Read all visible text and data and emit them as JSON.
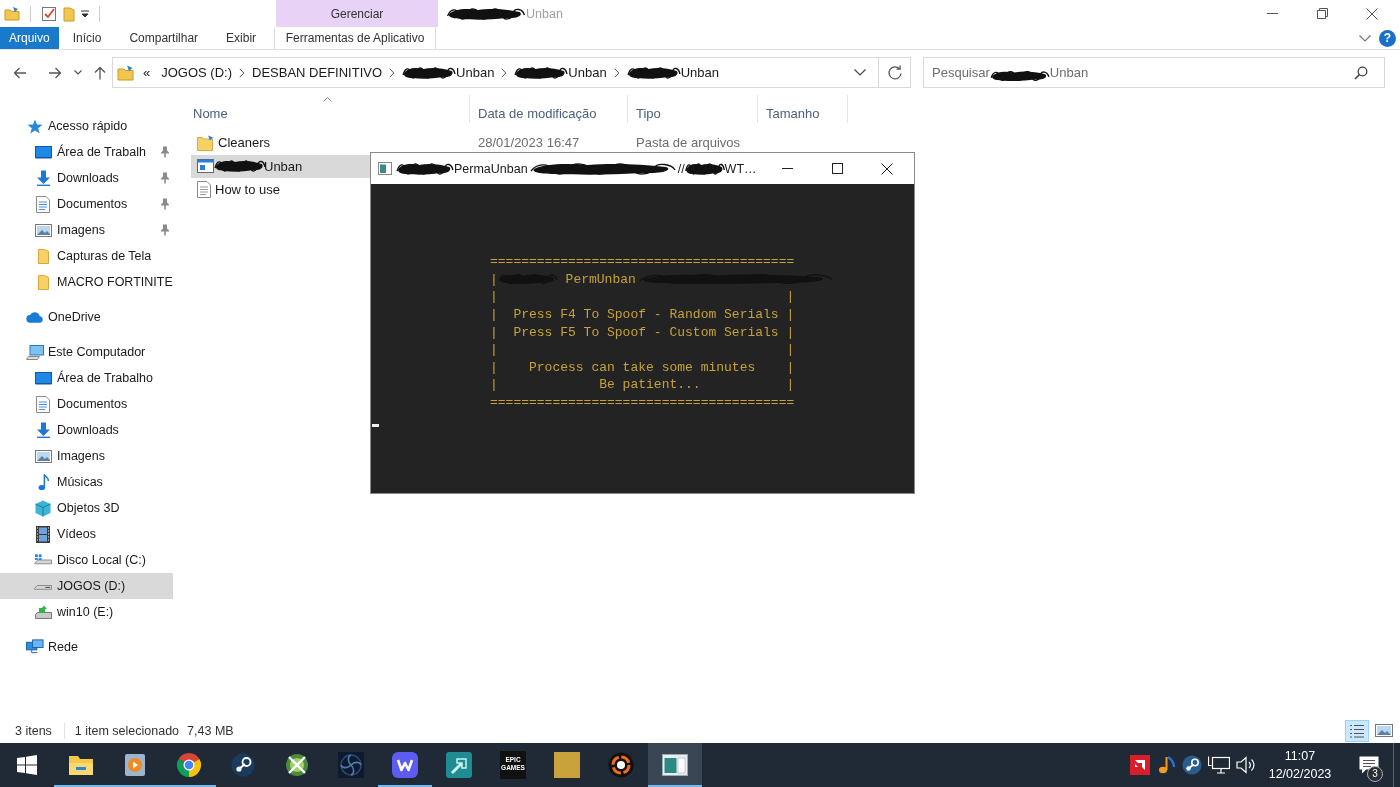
{
  "titlebar": {
    "context_group": "Gerenciar",
    "title": [
      {
        "kind": "scribble"
      },
      {
        "kind": "text",
        "text": "Unban"
      }
    ]
  },
  "ribbon": {
    "tabs": [
      {
        "label": "Arquivo",
        "kind": "file",
        "selected": false
      },
      {
        "label": "Início",
        "kind": "tab",
        "selected": false
      },
      {
        "label": "Compartilhar",
        "kind": "tab",
        "selected": false
      },
      {
        "label": "Exibir",
        "kind": "tab",
        "selected": false
      },
      {
        "label": "Ferramentas de Aplicativo",
        "kind": "context",
        "selected": false
      }
    ],
    "help": "?"
  },
  "address": {
    "overflow": "«",
    "crumbs": [
      {
        "parts": [
          {
            "kind": "text",
            "text": "JOGOS (D:)"
          }
        ]
      },
      {
        "parts": [
          {
            "kind": "text",
            "text": "DESBAN DEFINITIVO"
          }
        ]
      },
      {
        "parts": [
          {
            "kind": "scribble"
          },
          {
            "kind": "text",
            "text": "Unban"
          }
        ]
      },
      {
        "parts": [
          {
            "kind": "scribble"
          },
          {
            "kind": "text",
            "text": "Unban"
          }
        ]
      },
      {
        "parts": [
          {
            "kind": "scribble"
          },
          {
            "kind": "text",
            "text": "Unban"
          }
        ]
      }
    ]
  },
  "search": {
    "placeholder": [
      {
        "kind": "text",
        "text": "Pesquisar"
      },
      {
        "kind": "scribble"
      },
      {
        "kind": "text",
        "text": "Unban"
      }
    ]
  },
  "sidebar": {
    "items": [
      {
        "label": "Acesso rápido",
        "kind": "star",
        "selected": false,
        "children": [
          {
            "label": "Área de Trabalh",
            "kind": "desktop",
            "selected": false,
            "pinned": true
          },
          {
            "label": "Downloads",
            "kind": "download",
            "selected": false,
            "pinned": true
          },
          {
            "label": "Documentos",
            "kind": "document",
            "selected": false,
            "pinned": true
          },
          {
            "label": "Imagens",
            "kind": "picture",
            "selected": false,
            "pinned": true
          },
          {
            "label": "Capturas de Tela",
            "kind": "folder",
            "selected": false,
            "pinned": false
          },
          {
            "label": "MACRO FORTINITE",
            "kind": "folder",
            "selected": false,
            "pinned": false
          }
        ]
      },
      {
        "label": "OneDrive",
        "kind": "cloud",
        "selected": false
      },
      {
        "label": "Este Computador",
        "kind": "computer",
        "selected": false,
        "children": [
          {
            "label": "Área de Trabalho",
            "kind": "desktop",
            "selected": false
          },
          {
            "label": "Documentos",
            "kind": "document",
            "selected": false
          },
          {
            "label": "Downloads",
            "kind": "download",
            "selected": false
          },
          {
            "label": "Imagens",
            "kind": "picture",
            "selected": false
          },
          {
            "label": "Músicas",
            "kind": "music",
            "selected": false
          },
          {
            "label": "Objetos 3D",
            "kind": "cube",
            "selected": false
          },
          {
            "label": "Vídeos",
            "kind": "video",
            "selected": false
          },
          {
            "label": "Disco Local (C:)",
            "kind": "system-drive",
            "selected": false
          },
          {
            "label": "JOGOS (D:)",
            "kind": "drive",
            "selected": true
          },
          {
            "label": "win10 (E:)",
            "kind": "shared-drive",
            "selected": false
          }
        ]
      },
      {
        "label": "Rede",
        "kind": "network",
        "selected": false
      }
    ]
  },
  "file_list": {
    "columns": [
      {
        "label": "Nome",
        "sorted": true
      },
      {
        "label": "Data de modificação",
        "sorted": false
      },
      {
        "label": "Tipo",
        "sorted": false
      },
      {
        "label": "Tamanho",
        "sorted": false
      }
    ],
    "rows": [
      {
        "kind": "folder",
        "name": [
          {
            "kind": "text",
            "text": "Cleaners"
          }
        ],
        "date": "28/01/2023 16:47",
        "type": "Pasta de arquivos",
        "selected": false
      },
      {
        "kind": "app",
        "name": [
          {
            "kind": "scribble"
          },
          {
            "kind": "text",
            "text": "Unban"
          }
        ],
        "selected": true
      },
      {
        "kind": "document",
        "name": [
          {
            "kind": "text",
            "text": "How to use"
          }
        ],
        "selected": false
      }
    ]
  },
  "status_bar": {
    "count": "3 itens",
    "selection": "1 item selecionado",
    "size": "7,43 MB",
    "views": [
      {
        "kind": "details",
        "selected": true
      },
      {
        "kind": "large-icons",
        "selected": false
      }
    ]
  },
  "console": {
    "title": [
      {
        "kind": "scribble"
      },
      {
        "kind": "text",
        "text": "PermaUnban"
      },
      {
        "kind": "scribble"
      },
      {
        "kind": "text",
        "text": "//"
      },
      {
        "kind": "scribble"
      },
      {
        "kind": "text",
        "text": "WT…"
      }
    ],
    "lines": [
      {
        "parts": [
          {
            "kind": "text",
            "text": "======================================="
          }
        ]
      },
      {
        "parts": [
          {
            "kind": "text",
            "text": "|"
          },
          {
            "kind": "scribble"
          },
          {
            "kind": "text",
            "text": " PermUnban"
          },
          {
            "kind": "scribble"
          }
        ]
      },
      {
        "parts": [
          {
            "kind": "text",
            "text": "|                                     |"
          }
        ]
      },
      {
        "parts": [
          {
            "kind": "text",
            "text": "|  Press F4 To Spoof - Random Serials |"
          }
        ]
      },
      {
        "parts": [
          {
            "kind": "text",
            "text": "|  Press F5 To Spoof - Custom Serials |"
          }
        ]
      },
      {
        "parts": [
          {
            "kind": "text",
            "text": "|                                     |"
          }
        ]
      },
      {
        "parts": [
          {
            "kind": "text",
            "text": "|    Process can take some minutes    |"
          }
        ]
      },
      {
        "parts": [
          {
            "kind": "text",
            "text": "|             Be patient...           |"
          }
        ]
      },
      {
        "parts": [
          {
            "kind": "text",
            "text": "======================================="
          }
        ]
      }
    ]
  },
  "taskbar": {
    "apps": [
      {
        "kind": "folder",
        "running": true,
        "active": false
      },
      {
        "kind": "player",
        "running": true,
        "active": false
      },
      {
        "kind": "browser",
        "running": true,
        "active": false
      },
      {
        "kind": "game-client",
        "running": false,
        "active": false
      },
      {
        "kind": "sphere",
        "running": false,
        "active": false
      },
      {
        "kind": "fan",
        "running": false,
        "active": false
      },
      {
        "kind": "zigzag",
        "running": true,
        "active": false
      },
      {
        "kind": "arrow",
        "running": false,
        "active": false
      },
      {
        "kind": "logo-text",
        "label": "EPIC GAMES",
        "running": false,
        "active": false
      },
      {
        "kind": "photo",
        "running": false,
        "active": false
      },
      {
        "kind": "ring",
        "running": false,
        "active": false
      },
      {
        "kind": "console",
        "running": true,
        "active": true
      }
    ],
    "time": "11:07",
    "date": "12/02/2023",
    "notifications": "3"
  }
}
